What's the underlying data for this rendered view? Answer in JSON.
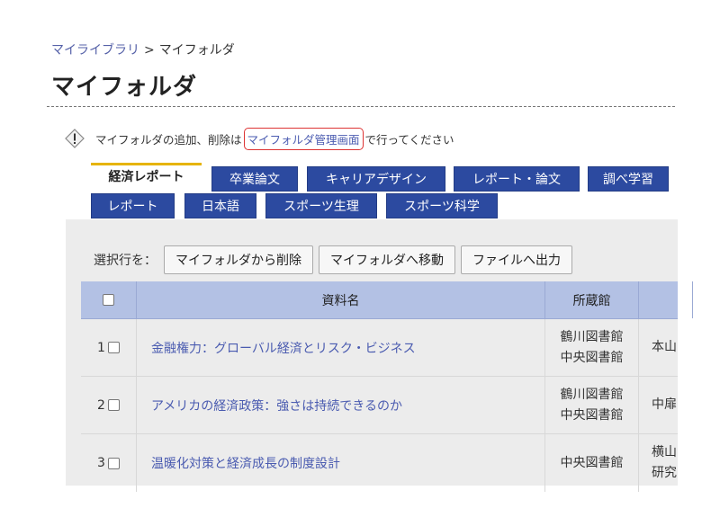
{
  "breadcrumb": {
    "parent": "マイライブラリ",
    "separator": ">",
    "current": "マイフォルダ"
  },
  "page_title": "マイフォルダ",
  "notice": {
    "prefix": "マイフォルダの追加、削除は",
    "link": "マイフォルダ管理画面",
    "suffix": "で行ってください"
  },
  "tabs_row1": [
    "経済レポート",
    "卒業論文",
    "キャリアデザイン",
    "レポート・論文",
    "調べ学習"
  ],
  "tabs_row2": [
    "レポート",
    "日本語",
    "スポーツ生理",
    "スポーツ科学"
  ],
  "toolbar": {
    "label": "選択行を：",
    "delete_label": "マイフォルダから削除",
    "move_label": "マイフォルダへ移動",
    "export_label": "ファイルへ出力"
  },
  "table": {
    "headers": [
      "資料名",
      "所蔵館"
    ],
    "rows": [
      {
        "num": "1",
        "title": "金融権力：グローバル経済とリスク・ビジネス",
        "libraries": [
          "鶴川図書館",
          "中央図書館"
        ],
        "extra": [
          "本山"
        ]
      },
      {
        "num": "2",
        "title": "アメリカの経済政策：強さは持続できるのか",
        "libraries": [
          "鶴川図書館",
          "中央図書館"
        ],
        "extra": [
          "中扉"
        ]
      },
      {
        "num": "3",
        "title": "温暖化対策と経済成長の制度設計",
        "libraries": [
          "中央図書館"
        ],
        "extra": [
          "横山",
          "研究"
        ]
      }
    ]
  }
}
